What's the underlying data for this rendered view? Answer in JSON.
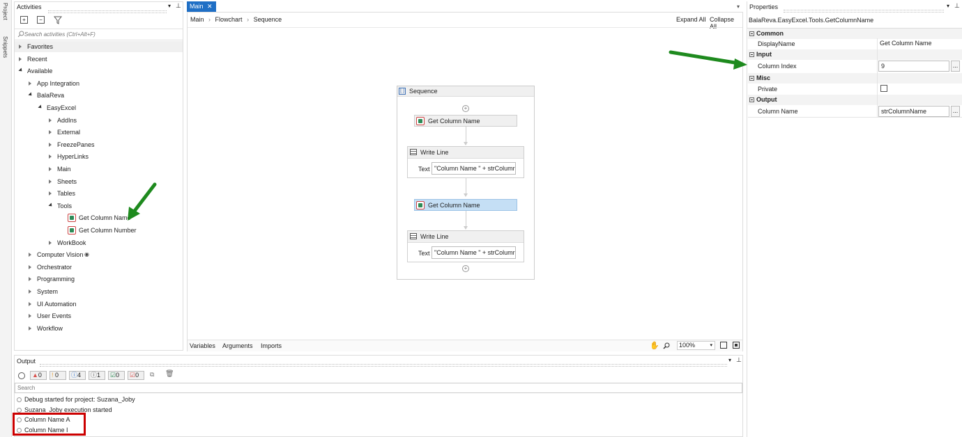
{
  "side_tabs": [
    "Project",
    "Snippets"
  ],
  "activities": {
    "title": "Activities",
    "search_placeholder": "Search activities (Ctrl+Alt+F)",
    "tree": [
      {
        "label": "Favorites",
        "level": 0,
        "state": "collapsed",
        "bg": true
      },
      {
        "label": "Recent",
        "level": 0,
        "state": "collapsed"
      },
      {
        "label": "Available",
        "level": 0,
        "state": "expanded"
      },
      {
        "label": "App Integration",
        "level": 1,
        "state": "collapsed"
      },
      {
        "label": "BalaReva",
        "level": 1,
        "state": "expanded"
      },
      {
        "label": "EasyExcel",
        "level": 2,
        "state": "expanded"
      },
      {
        "label": "AddIns",
        "level": 3,
        "state": "collapsed"
      },
      {
        "label": "External",
        "level": 3,
        "state": "collapsed"
      },
      {
        "label": "FreezePanes",
        "level": 3,
        "state": "collapsed"
      },
      {
        "label": "HyperLinks",
        "level": 3,
        "state": "collapsed"
      },
      {
        "label": "Main",
        "level": 3,
        "state": "collapsed"
      },
      {
        "label": "Sheets",
        "level": 3,
        "state": "collapsed"
      },
      {
        "label": "Tables",
        "level": 3,
        "state": "collapsed"
      },
      {
        "label": "Tools",
        "level": 3,
        "state": "expanded"
      },
      {
        "label": "Get Column Name",
        "level": 4,
        "state": "leaf"
      },
      {
        "label": "Get Column Number",
        "level": 4,
        "state": "leaf"
      },
      {
        "label": "WorkBook",
        "level": 3,
        "state": "collapsed"
      },
      {
        "label": "Computer Vision",
        "level": 1,
        "state": "collapsed",
        "eye": true
      },
      {
        "label": "Orchestrator",
        "level": 1,
        "state": "collapsed"
      },
      {
        "label": "Programming",
        "level": 1,
        "state": "collapsed"
      },
      {
        "label": "System",
        "level": 1,
        "state": "collapsed"
      },
      {
        "label": "UI Automation",
        "level": 1,
        "state": "collapsed"
      },
      {
        "label": "User Events",
        "level": 1,
        "state": "collapsed"
      },
      {
        "label": "Workflow",
        "level": 1,
        "state": "collapsed"
      }
    ]
  },
  "designer": {
    "tab": "Main",
    "breadcrumb": [
      "Main",
      "Flowchart",
      "Sequence"
    ],
    "expand_all": "Expand All",
    "collapse_all": "Collapse All",
    "sequence": {
      "title": "Sequence",
      "act1": "Get Column Name",
      "wl1_title": "Write Line",
      "wl1_label": "Text",
      "wl1_value": "\"Column Name \" + strColumr",
      "act2": "Get Column Name",
      "wl2_title": "Write Line",
      "wl2_label": "Text",
      "wl2_value": "\"Column Name \" + strColumr"
    },
    "bottom_tabs": [
      "Variables",
      "Arguments",
      "Imports"
    ],
    "zoom": "100%"
  },
  "properties": {
    "title": "Properties",
    "type": "BalaReva.EasyExcel.Tools.GetColumnName",
    "sec_common": "Common",
    "display_name_label": "DisplayName",
    "display_name_value": "Get Column Name",
    "sec_input": "Input",
    "column_index_label": "Column Index",
    "column_index_value": "9",
    "sec_misc": "Misc",
    "private_label": "Private",
    "sec_output": "Output",
    "column_name_label": "Column Name",
    "column_name_value": "strColumnName",
    "ellipsis": "..."
  },
  "output": {
    "title": "Output",
    "badges": [
      "0",
      "0",
      "4",
      "1",
      "0",
      "0"
    ],
    "badge_colors": [
      "#d9534f",
      "#e8a33d",
      "#3b7dd8",
      "#666666",
      "#2e8b57",
      "#d9534f"
    ],
    "search_placeholder": "Search",
    "logs": [
      "Debug started for project: Suzana_Joby",
      "Suzana_Joby execution started",
      "Column Name A",
      "Column Name I"
    ]
  },
  "highlight_color": "#cc0000",
  "arrow_color": "#1e8a1e"
}
